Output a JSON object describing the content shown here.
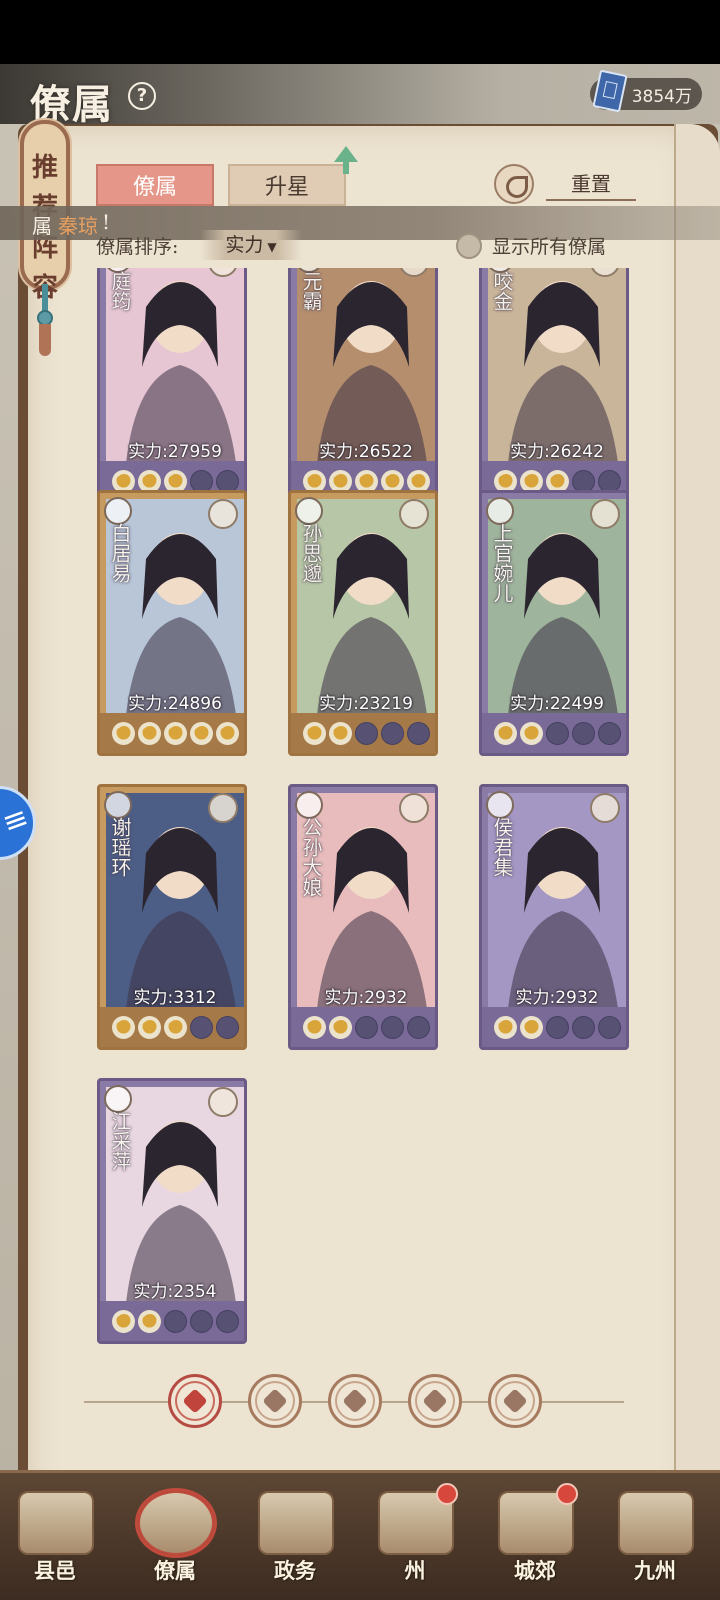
{
  "header": {
    "title": "僚属",
    "currency_amount": "3854万"
  },
  "side_tab": {
    "label": "推荐阵容"
  },
  "tabs": [
    {
      "label": "僚属",
      "active": true
    },
    {
      "label": "升星",
      "active": false
    }
  ],
  "reset_label": "重置",
  "toast": {
    "prefix": "属",
    "name": "秦琼",
    "suffix": "!"
  },
  "sort": {
    "label": "僚属排序:",
    "selected": "实力",
    "show_all_label": "显示所有僚属"
  },
  "cards": [
    {
      "name": "庭筠",
      "power": "实力:27959",
      "stars": 3,
      "rarity": "purple",
      "tone": "#e6c6d3"
    },
    {
      "name": "元霸",
      "power": "实力:26522",
      "stars": 5,
      "rarity": "purple",
      "tone": "#b58e6e"
    },
    {
      "name": "咬金",
      "power": "实力:26242",
      "stars": 3,
      "rarity": "purple",
      "tone": "#c9b59a"
    },
    {
      "name": "白居易",
      "power": "实力:24896",
      "stars": 5,
      "rarity": "gold",
      "tone": "#b9c6d8"
    },
    {
      "name": "孙思邈",
      "power": "实力:23219",
      "stars": 2,
      "rarity": "gold",
      "tone": "#b7c6a6"
    },
    {
      "name": "上官婉儿",
      "power": "实力:22499",
      "stars": 2,
      "rarity": "purple",
      "tone": "#9fb49c"
    },
    {
      "name": "谢瑶环",
      "power": "实力:3312",
      "stars": 3,
      "rarity": "gold",
      "tone": "#4d5e86"
    },
    {
      "name": "公孙大娘",
      "power": "实力:2932",
      "stars": 2,
      "rarity": "purple",
      "tone": "#e8bcbc"
    },
    {
      "name": "侯君集",
      "power": "实力:2932",
      "stars": 2,
      "rarity": "purple",
      "tone": "#a597c4"
    },
    {
      "name": "江采萍",
      "power": "实力:2354",
      "stars": 2,
      "rarity": "purple",
      "tone": "#e8d6e0"
    }
  ],
  "filters": [
    {
      "icon": "all-filter-icon",
      "active": true
    },
    {
      "icon": "bell-filter-icon",
      "active": false
    },
    {
      "icon": "tiger-filter-icon",
      "active": false
    },
    {
      "icon": "fan-filter-icon",
      "active": false
    },
    {
      "icon": "lion-filter-icon",
      "active": false
    }
  ],
  "bottom_nav": [
    {
      "label": "县邑",
      "badge": false,
      "active": false
    },
    {
      "label": "僚属",
      "badge": false,
      "active": true
    },
    {
      "label": "政务",
      "badge": false,
      "active": false
    },
    {
      "label": "州",
      "badge": true,
      "active": false
    },
    {
      "label": "城郊",
      "badge": true,
      "active": false
    },
    {
      "label": "九州",
      "badge": false,
      "active": false
    }
  ]
}
